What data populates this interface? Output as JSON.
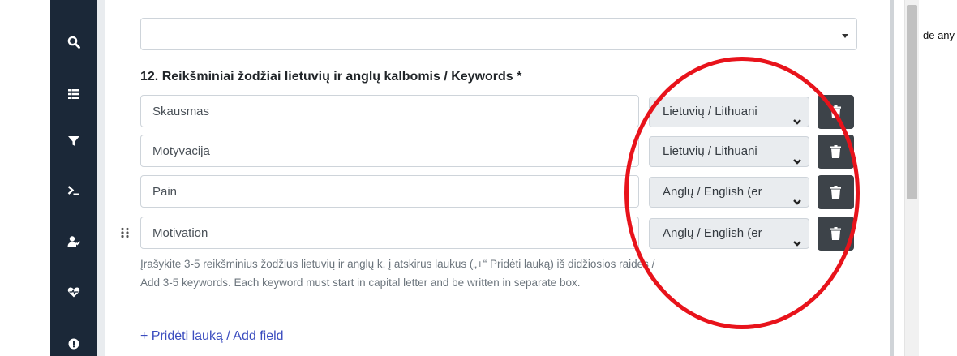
{
  "field": {
    "label": "12. Reikšminiai žodžiai lietuvių ir anglų kalbomis / Keywords *",
    "help": "Įrašykite 3-5 reikšminius žodžius lietuvių ir anglų k. į atskirus laukus („+“ Pridėti lauką) iš didžiosios raidės / Add 3-5 keywords. Each keyword must start in capital letter and be written in separate box.",
    "add_label": "+ Pridėti lauką / Add field"
  },
  "top_select": {
    "value": ""
  },
  "side_text": "de any",
  "keywords": [
    {
      "value": "Skausmas",
      "language": "Lietuvių / Lithuani"
    },
    {
      "value": "Motyvacija",
      "language": "Lietuvių / Lithuani"
    },
    {
      "value": "Pain",
      "language": "Anglų / English (er"
    },
    {
      "value": "Motivation",
      "language": "Anglų / English (er"
    }
  ],
  "sidebar": {
    "icons": [
      "search-icon",
      "list-icon",
      "filter-icon",
      "terminal-icon",
      "user-check-icon",
      "heartbeat-icon",
      "alert-icon"
    ]
  },
  "colors": {
    "sidebar_bg": "#1b2838",
    "delete_button_bg": "#3d4349",
    "link": "#3b4dbf",
    "annotation": "#e8131b"
  }
}
